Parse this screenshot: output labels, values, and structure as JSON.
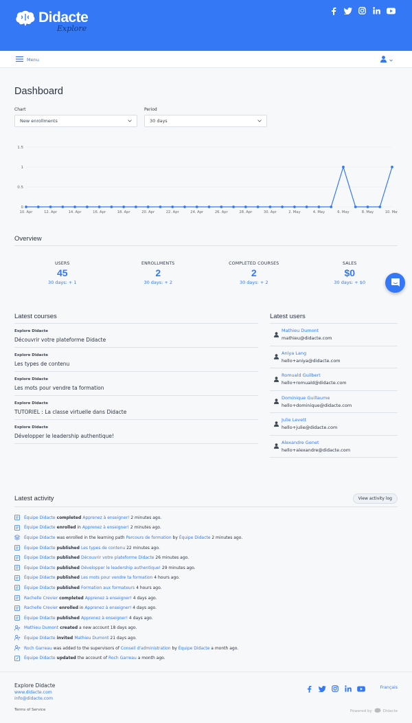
{
  "brand": {
    "name": "Didacte",
    "tagline": "Explore"
  },
  "colors": {
    "accent": "#3478f6",
    "header": "#3478f6"
  },
  "header": {
    "social": [
      "facebook-icon",
      "twitter-icon",
      "instagram-icon",
      "linkedin-icon",
      "youtube-icon"
    ]
  },
  "nav": {
    "menu_label": "Menu"
  },
  "page": {
    "title": "Dashboard"
  },
  "filters": {
    "chart_label": "Chart",
    "chart_value": "New enrollments",
    "period_label": "Period",
    "period_value": "30 days"
  },
  "chart_data": {
    "type": "line",
    "x": [
      "10. Apr",
      "11. Apr",
      "12. Apr",
      "13. Apr",
      "14. Apr",
      "15. Apr",
      "16. Apr",
      "17. Apr",
      "18. Apr",
      "19. Apr",
      "20. Apr",
      "21. Apr",
      "22. Apr",
      "23. Apr",
      "24. Apr",
      "25. Apr",
      "26. Apr",
      "27. Apr",
      "28. Apr",
      "29. Apr",
      "30. Apr",
      "1. May",
      "2. May",
      "3. May",
      "4. May",
      "5. May",
      "6. May",
      "7. May",
      "8. May",
      "9. May",
      "10. May"
    ],
    "values": [
      0,
      0,
      0,
      0,
      0,
      0,
      0,
      0,
      0,
      0,
      0,
      0,
      0,
      0,
      0,
      0,
      0,
      0,
      0,
      0,
      0,
      0,
      0,
      0,
      0,
      0,
      1,
      0,
      0,
      0,
      1
    ],
    "xticks": [
      "10. Apr",
      "12. Apr",
      "14. Apr",
      "16. Apr",
      "18. Apr",
      "20. Apr",
      "22. Apr",
      "24. Apr",
      "26. Apr",
      "28. Apr",
      "30. Apr",
      "2. May",
      "4. May",
      "6. May",
      "8. May",
      "10. May"
    ],
    "yticks": [
      "0",
      "0.5",
      "1",
      "1.5"
    ],
    "ylim": [
      0,
      1.5
    ],
    "grid": true
  },
  "overview": {
    "title": "Overview",
    "stats": [
      {
        "label": "USERS",
        "value": "45",
        "delta": "30 days: + 1"
      },
      {
        "label": "ENROLLMENTS",
        "value": "2",
        "delta": "30 days: + 2"
      },
      {
        "label": "COMPLETED COURSES",
        "value": "2",
        "delta": "30 days: + 2"
      },
      {
        "label": "SALES",
        "value": "$0",
        "delta": "30 days: + $0"
      }
    ]
  },
  "courses": {
    "title": "Latest courses",
    "items": [
      {
        "cat": "Explore Didacte",
        "name": "Découvrir votre plateforme Didacte"
      },
      {
        "cat": "Explore Didacte",
        "name": "Les types de contenu"
      },
      {
        "cat": "Explore Didacte",
        "name": "Les mots pour vendre ta formation"
      },
      {
        "cat": "Explore Didacte",
        "name": "TUTORIEL : La classe virtuelle dans Didacte"
      },
      {
        "cat": "Explore Didacte",
        "name": "Développer le leadership authentique!"
      }
    ]
  },
  "users": {
    "title": "Latest users",
    "items": [
      {
        "name": "Mathieu Dumont",
        "email": "mathieu@didacte.com"
      },
      {
        "name": "Aniya Lang",
        "email": "hello+aniya@didacte.com"
      },
      {
        "name": "Romuald Guilbert",
        "email": "hello+romuald@didacte.com"
      },
      {
        "name": "Dominique Guillaume",
        "email": "hello+dominique@didacte.com"
      },
      {
        "name": "Julie Levett",
        "email": "hello+julie@didacte.com"
      },
      {
        "name": "Alexandre Genet",
        "email": "hello+alexandre@didacte.com"
      }
    ]
  },
  "activity": {
    "title": "Latest activity",
    "log_button": "View activity log",
    "items": [
      {
        "icon": "course-icon",
        "parts": [
          [
            "l",
            "Équipe Didacte"
          ],
          [
            "b",
            " completed "
          ],
          [
            "l",
            "Apprenez à enseigner!"
          ],
          [
            "t",
            " 2 minutes ago."
          ]
        ]
      },
      {
        "icon": "course-icon",
        "parts": [
          [
            "l",
            "Équipe Didacte"
          ],
          [
            "b",
            " enrolled"
          ],
          [
            "t",
            " in "
          ],
          [
            "l",
            "Apprenez à enseigner!"
          ],
          [
            "t",
            " 2 minutes ago."
          ]
        ]
      },
      {
        "icon": "path-icon",
        "parts": [
          [
            "l",
            "Équipe Didacte"
          ],
          [
            "t",
            " was enrolled in the learning path "
          ],
          [
            "l",
            "Parcours de formation"
          ],
          [
            "t",
            " by "
          ],
          [
            "l",
            "Équipe Didacte"
          ],
          [
            "t",
            " 2 minutes ago."
          ]
        ]
      },
      {
        "icon": "course-icon",
        "parts": [
          [
            "l",
            "Équipe Didacte"
          ],
          [
            "b",
            " published "
          ],
          [
            "l",
            "Les types de contenu"
          ],
          [
            "t",
            " 22 minutes ago."
          ]
        ]
      },
      {
        "icon": "course-icon",
        "parts": [
          [
            "l",
            "Équipe Didacte"
          ],
          [
            "b",
            " published "
          ],
          [
            "l",
            "Découvrir votre plateforme Didacte"
          ],
          [
            "t",
            " 26 minutes ago."
          ]
        ]
      },
      {
        "icon": "course-icon",
        "parts": [
          [
            "l",
            "Équipe Didacte"
          ],
          [
            "b",
            " published "
          ],
          [
            "l",
            "Développer le leadership authentique!"
          ],
          [
            "t",
            " 29 minutes ago."
          ]
        ]
      },
      {
        "icon": "course-icon",
        "parts": [
          [
            "l",
            "Équipe Didacte"
          ],
          [
            "b",
            " published "
          ],
          [
            "l",
            "Les mots pour vendre ta formation"
          ],
          [
            "t",
            " 4 hours ago."
          ]
        ]
      },
      {
        "icon": "course-icon",
        "parts": [
          [
            "l",
            "Équipe Didacte"
          ],
          [
            "b",
            " published "
          ],
          [
            "l",
            "Formation aux formateurs"
          ],
          [
            "t",
            " 4 hours ago."
          ]
        ]
      },
      {
        "icon": "course-icon",
        "parts": [
          [
            "l",
            "Rachelle Crevier"
          ],
          [
            "b",
            " completed "
          ],
          [
            "l",
            "Apprenez à enseigner!"
          ],
          [
            "t",
            " 4 days ago."
          ]
        ]
      },
      {
        "icon": "course-icon",
        "parts": [
          [
            "l",
            "Rachelle Crevier"
          ],
          [
            "b",
            " enrolled"
          ],
          [
            "t",
            " in "
          ],
          [
            "l",
            "Apprenez à enseigner!"
          ],
          [
            "t",
            " 4 days ago."
          ]
        ]
      },
      {
        "icon": "course-icon",
        "parts": [
          [
            "l",
            "Équipe Didacte"
          ],
          [
            "b",
            " published "
          ],
          [
            "l",
            "Apprenez à enseigner!"
          ],
          [
            "t",
            " 4 days ago."
          ]
        ]
      },
      {
        "icon": "user-add-icon",
        "parts": [
          [
            "l",
            "Mathieu Dumont"
          ],
          [
            "b",
            " created"
          ],
          [
            "t",
            " a new account 18 days ago."
          ]
        ]
      },
      {
        "icon": "user-add-icon",
        "parts": [
          [
            "l",
            "Équipe Didacte"
          ],
          [
            "b",
            " invited "
          ],
          [
            "l",
            "Mathieu Dumont"
          ],
          [
            "t",
            " 21 days ago."
          ]
        ]
      },
      {
        "icon": "user-add-icon",
        "parts": [
          [
            "l",
            "Roch Garreau"
          ],
          [
            "t",
            " was added to the supervisors of "
          ],
          [
            "l",
            "Conseil d'administration"
          ],
          [
            "t",
            " by "
          ],
          [
            "l",
            "Équipe Didacte"
          ],
          [
            "t",
            " a month ago."
          ]
        ]
      },
      {
        "icon": "user-edit-icon",
        "parts": [
          [
            "l",
            "Équipe Didacte"
          ],
          [
            "b",
            " updated"
          ],
          [
            "t",
            " the account of "
          ],
          [
            "l",
            "Roch Garreau"
          ],
          [
            "t",
            " a month ago."
          ]
        ]
      }
    ]
  },
  "footer": {
    "name": "Explore Didacte",
    "site": "www.didacte.com",
    "email": "info@didacte.com",
    "terms": "Terms of Service",
    "lang": "Français",
    "powered_label": "Powered by",
    "powered_brand": "Didacte",
    "social": [
      "facebook-icon",
      "twitter-icon",
      "instagram-icon",
      "linkedin-icon",
      "youtube-icon"
    ]
  }
}
